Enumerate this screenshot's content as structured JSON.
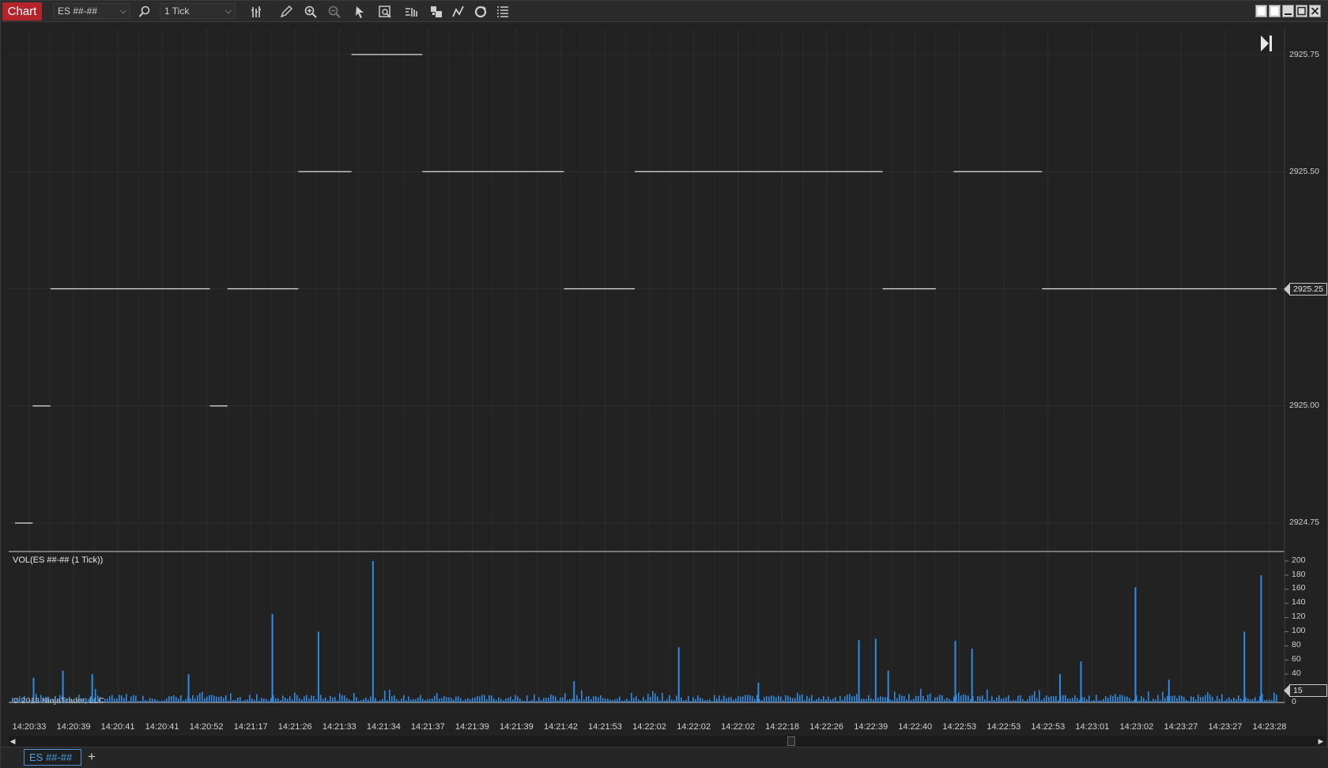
{
  "toolbar": {
    "window_title": "Chart",
    "instrument": "ES ##-##",
    "interval": "1 Tick"
  },
  "price_axis": {
    "labels": [
      "2925.75",
      "2925.50",
      "2925.25",
      "2925.00",
      "2924.75"
    ],
    "current_price": "2925.25"
  },
  "indicator": {
    "title": "VOL(ES ##-## (1 Tick))",
    "axis_labels": [
      "200",
      "180",
      "160",
      "140",
      "120",
      "100",
      "80",
      "60",
      "40",
      "15",
      "0"
    ],
    "current_value": "15"
  },
  "copyright": "© 2018 NinjaTrader, LLC",
  "time_axis": {
    "labels": [
      "14:20:33",
      "14:20:39",
      "14:20:41",
      "14:20:41",
      "14:20:52",
      "14:21:17",
      "14:21:26",
      "14:21:33",
      "14:21:34",
      "14:21:37",
      "14:21:39",
      "14:21:39",
      "14:21:42",
      "14:21:53",
      "14:22:02",
      "14:22:02",
      "14:22:02",
      "14:22:18",
      "14:22:26",
      "14:22:39",
      "14:22:40",
      "14:22:53",
      "14:22:53",
      "14:22:53",
      "14:23:01",
      "14:23:02",
      "14:23:27",
      "14:23:27",
      "14:23:28"
    ]
  },
  "bottom_tabs": {
    "active": "ES ##-##",
    "add_label": "+"
  },
  "colors": {
    "accent": "#b5232b",
    "volume": "#2f8ce6",
    "price_line": "#e0e0e0",
    "background": "#222222",
    "grid": "#2e2e2e"
  },
  "chart_data": {
    "type": "line",
    "price_segments": [
      {
        "start": 0,
        "end": 1,
        "price": 2924.75
      },
      {
        "start": 1,
        "end": 2,
        "price": 2925.0
      },
      {
        "start": 2,
        "end": 11,
        "price": 2925.25
      },
      {
        "start": 11,
        "end": 12,
        "price": 2925.0
      },
      {
        "start": 12,
        "end": 16,
        "price": 2925.25
      },
      {
        "start": 16,
        "end": 19,
        "price": 2925.5
      },
      {
        "start": 19,
        "end": 23,
        "price": 2925.75
      },
      {
        "start": 23,
        "end": 31,
        "price": 2925.5
      },
      {
        "start": 31,
        "end": 35,
        "price": 2925.25
      },
      {
        "start": 35,
        "end": 42,
        "price": 2925.5
      },
      {
        "start": 42,
        "end": 49,
        "price": 2925.5
      },
      {
        "start": 49,
        "end": 52,
        "price": 2925.25
      },
      {
        "start": 53,
        "end": 58,
        "price": 2925.5
      },
      {
        "start": 58,
        "end": 68,
        "price": 2925.25
      },
      {
        "start": 68,
        "end": 72,
        "price": 2925.25
      }
    ],
    "volume_spikes": [
      {
        "x": 0.05,
        "v": 35
      },
      {
        "x": 0.12,
        "v": 45
      },
      {
        "x": 0.19,
        "v": 40
      },
      {
        "x": 0.42,
        "v": 40
      },
      {
        "x": 0.62,
        "v": 125
      },
      {
        "x": 0.73,
        "v": 100
      },
      {
        "x": 0.86,
        "v": 200
      },
      {
        "x": 1.34,
        "v": 30
      },
      {
        "x": 1.59,
        "v": 78
      },
      {
        "x": 1.78,
        "v": 28
      },
      {
        "x": 2.02,
        "v": 88
      },
      {
        "x": 2.06,
        "v": 90
      },
      {
        "x": 2.09,
        "v": 45
      },
      {
        "x": 2.25,
        "v": 87
      },
      {
        "x": 2.29,
        "v": 76
      },
      {
        "x": 2.5,
        "v": 40
      },
      {
        "x": 2.55,
        "v": 58
      },
      {
        "x": 2.68,
        "v": 163
      },
      {
        "x": 2.76,
        "v": 32
      },
      {
        "x": 2.94,
        "v": 100
      },
      {
        "x": 2.98,
        "v": 180
      }
    ],
    "y_range": [
      2924.75,
      2925.75
    ],
    "volume_range": [
      0,
      200
    ],
    "grid": true
  }
}
